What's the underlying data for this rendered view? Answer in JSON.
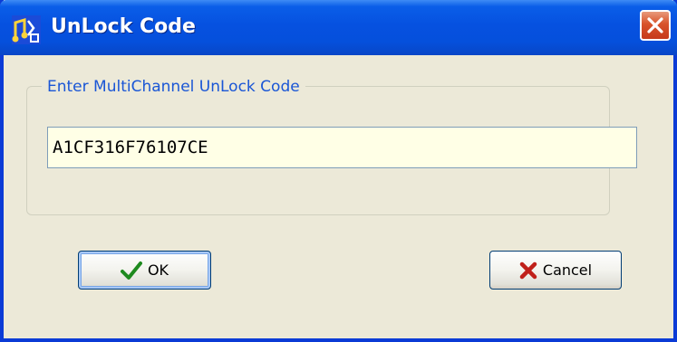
{
  "window": {
    "title": "UnLock Code"
  },
  "titlebar": {
    "app_icon": "music-note-app-icon",
    "close_icon": "close-icon"
  },
  "group": {
    "label": "Enter MultiChannel UnLock Code"
  },
  "unlock_input": {
    "value": "A1CF316F76107CE"
  },
  "buttons": {
    "ok_label": "OK",
    "ok_icon": "checkmark-icon",
    "cancel_label": "Cancel",
    "cancel_icon": "red-x-icon"
  },
  "colors": {
    "titlebar_blue": "#0651e0",
    "group_label_blue": "#1a56d6",
    "input_background": "#ffffe6",
    "close_red": "#d8532a",
    "check_green": "#1e8a1e",
    "cancel_red": "#c0201a"
  }
}
